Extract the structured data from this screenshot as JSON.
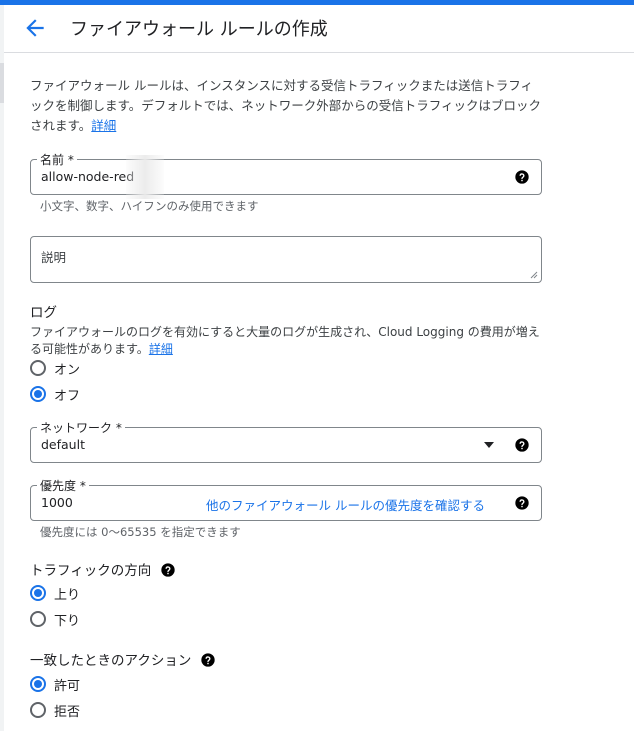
{
  "header": {
    "title": "ファイアウォール ルールの作成"
  },
  "intro": {
    "text": "ファイアウォール ルールは、インスタンスに対する受信トラフィックまたは送信トラフィックを制御します。デフォルトでは、ネットワーク外部からの受信トラフィックはブロックされます。",
    "link": "詳細"
  },
  "name_field": {
    "label": "名前 *",
    "value": "allow-node-red",
    "hint": "小文字、数字、ハイフンのみ使用できます"
  },
  "description_field": {
    "placeholder": "説明"
  },
  "logs": {
    "title": "ログ",
    "desc": "ファイアウォールのログを有効にすると大量のログが生成され、Cloud Logging の費用が増える可能性があります。",
    "link": "詳細",
    "options": [
      {
        "label": "オン",
        "checked": false
      },
      {
        "label": "オフ",
        "checked": true
      }
    ]
  },
  "network_field": {
    "label": "ネットワーク *",
    "value": "default"
  },
  "priority_field": {
    "label": "優先度 *",
    "value": "1000",
    "link": "他のファイアウォール ルールの優先度を確認する",
    "hint": "優先度には 0～65535 を指定できます"
  },
  "direction": {
    "title": "トラフィックの方向",
    "options": [
      {
        "label": "上り",
        "checked": true
      },
      {
        "label": "下り",
        "checked": false
      }
    ]
  },
  "action": {
    "title": "一致したときのアクション",
    "options": [
      {
        "label": "許可",
        "checked": true
      },
      {
        "label": "拒否",
        "checked": false
      }
    ]
  },
  "colors": {
    "accent": "#1a73e8",
    "text": "#202124",
    "muted": "#5f6368",
    "border": "#80868b"
  }
}
